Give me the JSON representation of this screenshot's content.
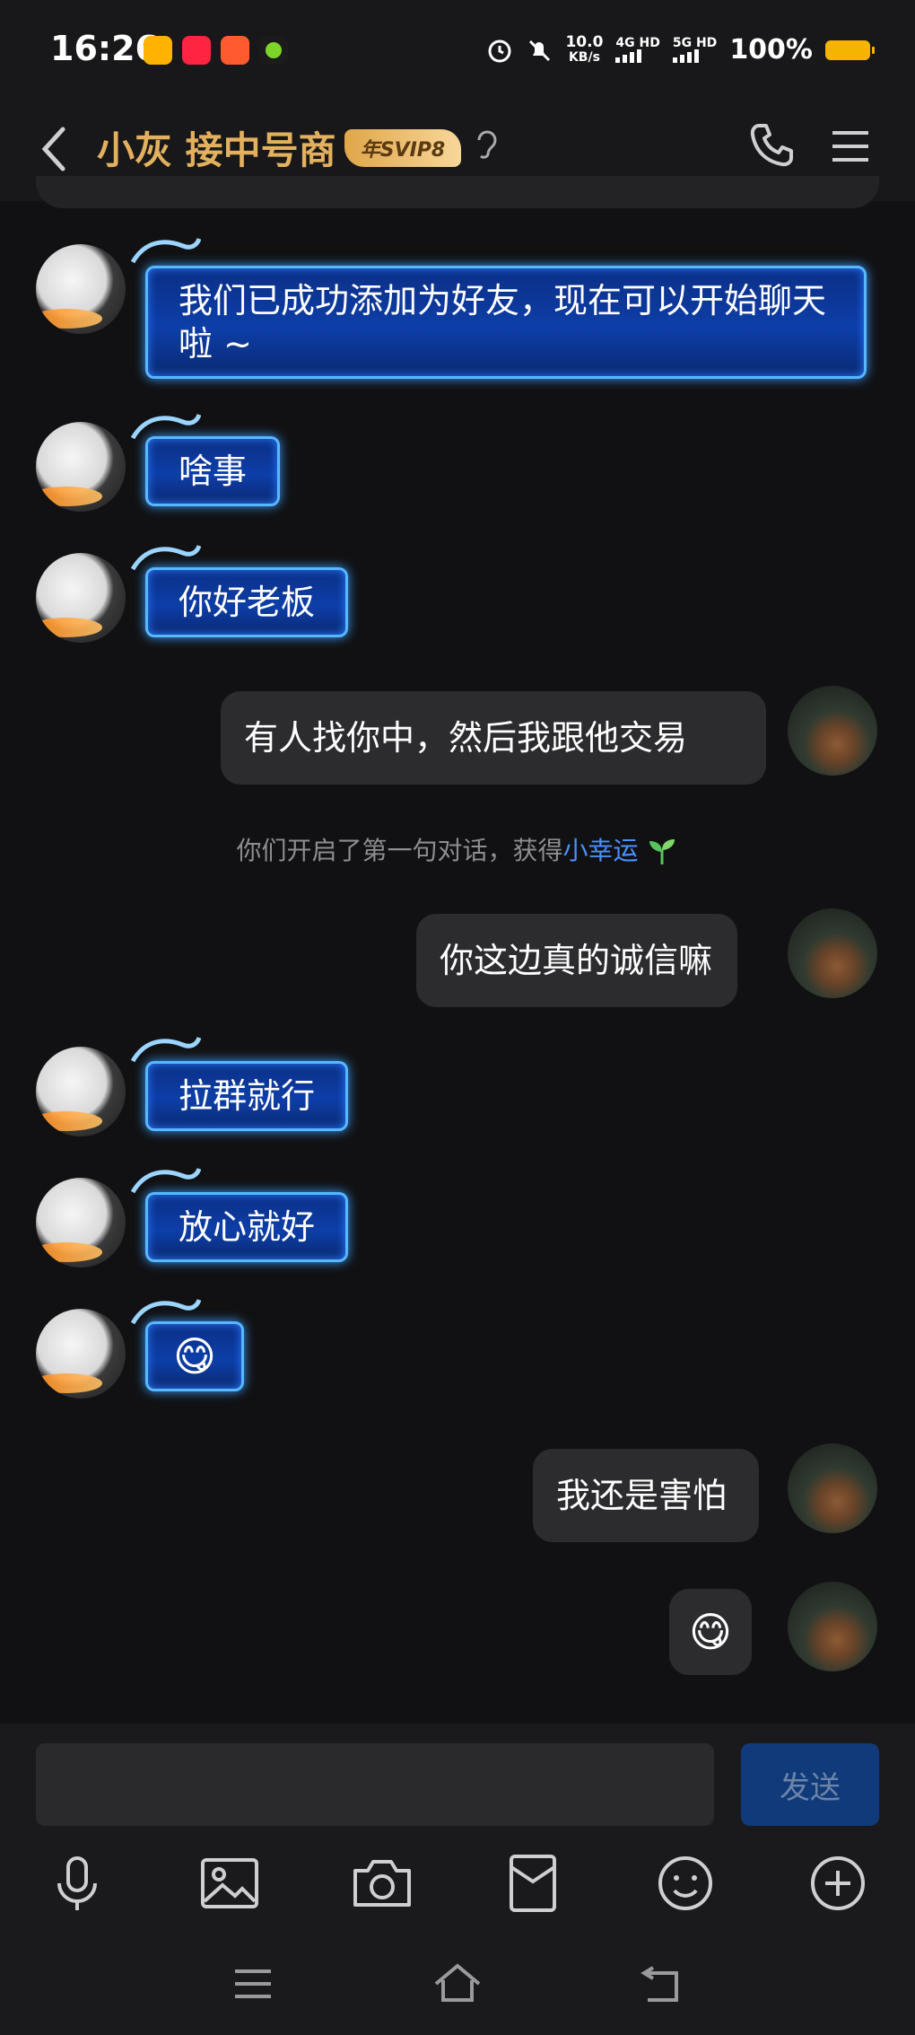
{
  "status_bar": {
    "time": "16:26",
    "speed_value": "10.0",
    "speed_unit": "KB/s",
    "net1": "4G HD",
    "net2": "5G HD",
    "battery": "100%"
  },
  "header": {
    "title": "小灰 接中号商",
    "vip_badge": "年SVIP8"
  },
  "messages": [
    {
      "side": "in",
      "text": "我们已成功添加为好友，现在可以开始聊天啦 ~"
    },
    {
      "side": "in",
      "text": "啥事"
    },
    {
      "side": "in",
      "text": "你好老板"
    },
    {
      "side": "out",
      "text": "有人找你中，然后我跟他交易"
    },
    {
      "side": "out",
      "text": "你这边真的诚信嘛"
    },
    {
      "side": "in",
      "text": "拉群就行"
    },
    {
      "side": "in",
      "text": "放心就好"
    },
    {
      "side": "in",
      "text": "😋"
    },
    {
      "side": "out",
      "text": "我还是害怕"
    },
    {
      "side": "out",
      "text": "😋"
    }
  ],
  "system_notice": {
    "text": "你们开启了第一句对话，获得",
    "highlight": "小幸运",
    "icon": "sprout-icon"
  },
  "composer": {
    "send_label": "发送",
    "tools": [
      "mic-icon",
      "image-icon",
      "camera-icon",
      "red-packet-icon",
      "emoji-icon",
      "plus-icon"
    ]
  },
  "colors": {
    "accent_gold": "#e3b15e",
    "bubble_in": "#0d3ea8",
    "bubble_out": "#2c2c2f",
    "send_button": "#113a7a",
    "luck_link": "#4a90ff"
  }
}
